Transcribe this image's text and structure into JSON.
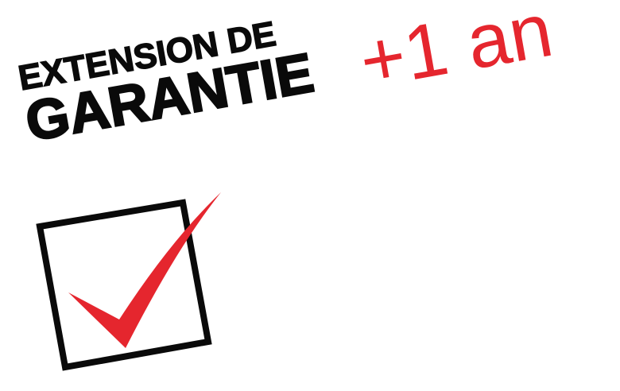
{
  "title": {
    "line1": "EXTENSION DE",
    "line2": "GARANTIE"
  },
  "accent_text": "+1 an",
  "icons": {
    "checkbox": "checked-box-icon",
    "checkmark": "checkmark-icon"
  },
  "colors": {
    "text": "#0a0a0a",
    "accent": "#e5262e",
    "background": "#ffffff"
  }
}
